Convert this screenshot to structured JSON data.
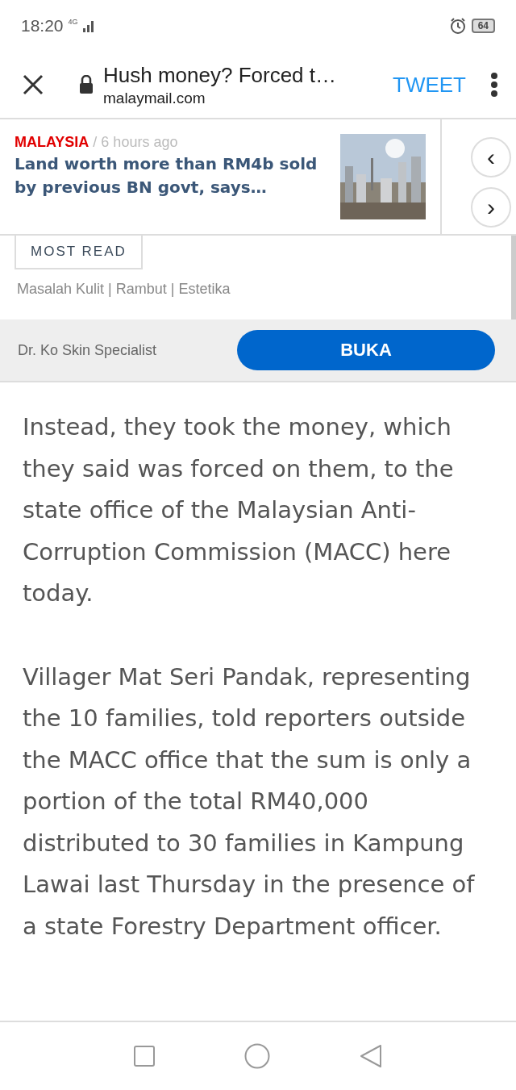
{
  "status_bar": {
    "time": "18:20",
    "network": "4G",
    "battery": "64"
  },
  "toolbar": {
    "title": "Hush money? Forced t…",
    "domain": "malaymail.com",
    "action": "TWEET"
  },
  "carousel": {
    "cards": [
      {
        "category": "MALAYSIA",
        "age": "/ 6 hours ago",
        "headline": "Land worth more than RM4b sold by previous BN govt, says…",
        "kind": "picture"
      }
    ],
    "prev": "‹",
    "next": "›"
  },
  "ad": {
    "tab": "MOST READ",
    "tagline": "Masalah Kulit | Rambut | Estetika",
    "advertiser": "Dr. Ko Skin Specialist",
    "button": "BUKA"
  },
  "article": {
    "paragraphs": [
      "Instead, they took the money, which they said was forced on them, to the state office of the Malaysian Anti-Corruption Commission (MACC) here today.",
      "Villager Mat Seri Pandak, representing the 10 families, told reporters outside the MACC office that the sum is only a portion of the total RM40,000 distributed to 30 families in Kampung Lawai last Thursday in the presence of a state Forestry Department officer."
    ]
  }
}
